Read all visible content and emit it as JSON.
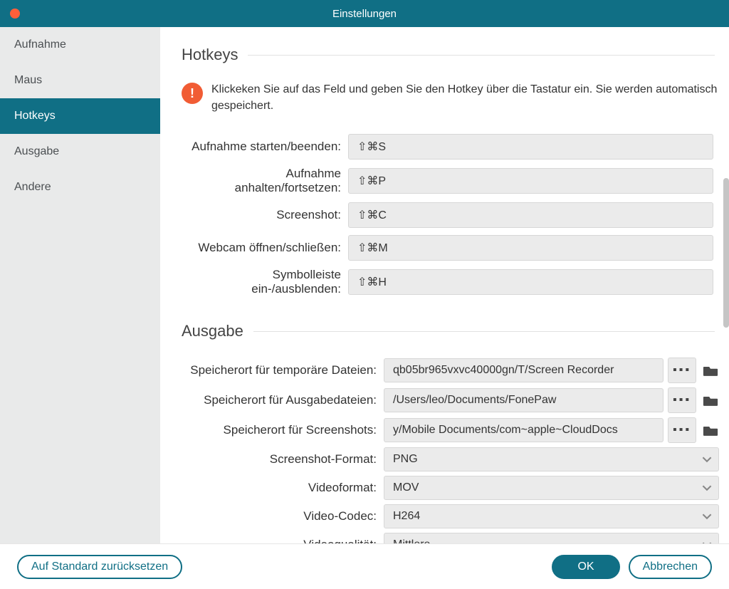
{
  "titlebar": {
    "title": "Einstellungen"
  },
  "sidebar": {
    "items": [
      {
        "label": "Aufnahme"
      },
      {
        "label": "Maus"
      },
      {
        "label": "Hotkeys"
      },
      {
        "label": "Ausgabe"
      },
      {
        "label": "Andere"
      }
    ]
  },
  "hotkeys": {
    "header": "Hotkeys",
    "alert_text": "Klickeken Sie auf das Feld und geben Sie den Hotkey über die Tastatur ein. Sie werden automatisch gespeichert.",
    "rows": [
      {
        "label": "Aufnahme starten/beenden:",
        "value": "⇧⌘S"
      },
      {
        "label": "Aufnahme anhalten/fortsetzen:",
        "value": "⇧⌘P"
      },
      {
        "label": "Screenshot:",
        "value": "⇧⌘C"
      },
      {
        "label": "Webcam öffnen/schließen:",
        "value": "⇧⌘M"
      },
      {
        "label": "Symbolleiste ein-/ausblenden:",
        "value": "⇧⌘H"
      }
    ]
  },
  "ausgabe": {
    "header": "Ausgabe",
    "paths": [
      {
        "label": "Speicherort für temporäre Dateien:",
        "value": "ɋb05br965vxvc40000gn/T/Screen Recorder",
        "more": "▪▪▪"
      },
      {
        "label": "Speicherort für Ausgabedateien:",
        "value": "/Users/leo/Documents/FonePaw",
        "more": "▪▪▪"
      },
      {
        "label": "Speicherort für Screenshots:",
        "value": "y/Mobile Documents/com~apple~CloudDocs",
        "more": "▪▪▪"
      }
    ],
    "selects": [
      {
        "label": "Screenshot-Format:",
        "value": "PNG"
      },
      {
        "label": "Videoformat:",
        "value": "MOV"
      },
      {
        "label": "Video-Codec:",
        "value": "H264"
      },
      {
        "label": "Videoqualität:",
        "value": "Mittlere"
      }
    ]
  },
  "footer": {
    "reset": "Auf Standard zurücksetzen",
    "ok": "OK",
    "cancel": "Abbrechen"
  }
}
